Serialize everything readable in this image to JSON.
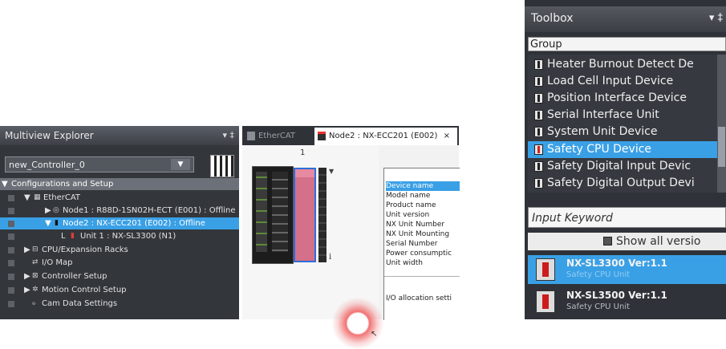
{
  "explorer": {
    "title": "Multiview Explorer",
    "title_icons": "▾ ‡",
    "controller": "new_Controller_0",
    "tree": [
      {
        "label": "Configurations and Setup",
        "icon": "",
        "toggle": "▼"
      },
      {
        "label": "EtherCAT",
        "icon": "ethercat-icon",
        "toggle": "▼"
      },
      {
        "label": "Node1 : R88D-1SN02H-ECT (E001) : Offline",
        "icon": "servo-drive-icon",
        "toggle": "▶"
      },
      {
        "label": "Node2 : NX-ECC201 (E002) : Offline",
        "icon": "coupler-icon",
        "toggle": "▼"
      },
      {
        "label": "Unit 1 : NX-SL3300 (N1)",
        "icon": "safety-unit-icon",
        "toggle": "L"
      },
      {
        "label": "CPU/Expansion Racks",
        "icon": "rack-icon",
        "toggle": "▶"
      },
      {
        "label": "I/O Map",
        "icon": "io-map-icon",
        "toggle": ""
      },
      {
        "label": "Controller Setup",
        "icon": "controller-setup-icon",
        "toggle": "▶"
      },
      {
        "label": "Motion Control Setup",
        "icon": "motion-icon",
        "toggle": "▶"
      },
      {
        "label": "Cam Data Settings",
        "icon": "cam-icon",
        "toggle": ""
      }
    ]
  },
  "editor": {
    "tabs": [
      {
        "label": "EtherCAT"
      },
      {
        "label": "Node2 : NX-ECC201 (E002)",
        "close": "×"
      }
    ],
    "slot_number": "1",
    "info_glyph": "i",
    "properties": [
      "Device name",
      "Model name",
      "Product name",
      "Unit version",
      "NX Unit Number",
      "NX Unit Mounting",
      "Serial Number",
      "Power consumptic",
      "Unit width",
      "I/O allocation setti"
    ]
  },
  "toolbox": {
    "title": "Toolbox",
    "title_icons": "▾ ‡",
    "group_label": "Group",
    "groups": [
      "Heater Burnout Detect De",
      "Load Cell Input Device",
      "Position Interface Device",
      "Serial Interface Unit",
      "System Unit Device",
      "Safety CPU Device",
      "Safety Digital Input Devic",
      "Safety Digital Output Devi"
    ],
    "selected_group": "Safety CPU Device",
    "keyword_placeholder": "Input Keyword",
    "show_all": "Show all versio",
    "results": [
      {
        "name": "NX-SL3300 Ver:1.1",
        "sub": "Safety CPU Unit"
      },
      {
        "name": "NX-SL3500 Ver:1.1",
        "sub": "Safety CPU Unit"
      }
    ]
  }
}
